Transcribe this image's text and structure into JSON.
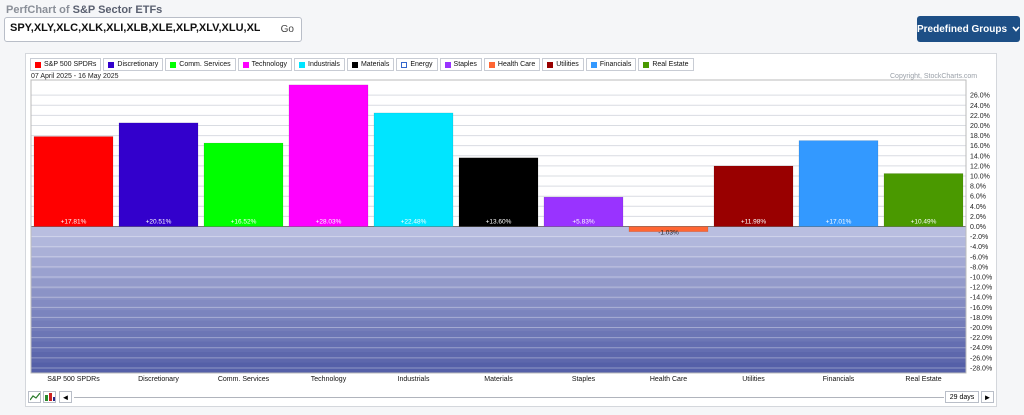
{
  "header": {
    "title_prefix": "PerfChart of ",
    "title_main": "S&P Sector ETFs",
    "symbols_value": "SPY,XLY,XLC,XLK,XLI,XLB,XLE,XLP,XLV,XLU,XLF,XLRE",
    "go_label": "Go",
    "groups_label": "Predefined Groups",
    "groups_icon": "chevron-down-icon"
  },
  "chart_header": {
    "date_range": "07 April 2025 - 16 May 2025",
    "copyright": "Copyright, StockCharts.com"
  },
  "footer": {
    "days_label": "29 days",
    "left_arrow": "◄",
    "right_arrow": "►"
  },
  "chart_data": {
    "type": "bar",
    "categories": [
      "S&P 500 SPDRs",
      "Discretionary",
      "Comm. Services",
      "Technology",
      "Industrials",
      "Materials",
      "Staples",
      "Health Care",
      "Utilities",
      "Financials",
      "Real Estate"
    ],
    "values": [
      17.81,
      20.51,
      16.52,
      28.03,
      22.48,
      13.6,
      5.83,
      -1.03,
      11.98,
      17.01,
      10.49
    ],
    "value_labels": [
      "+17.81%",
      "+20.51%",
      "+16.52%",
      "+28.03%",
      "+22.48%",
      "+13.60%",
      "+5.83%",
      "-1.03%",
      "+11.98%",
      "+17.01%",
      "+10.49%"
    ],
    "colors": [
      "#ff0000",
      "#3300cc",
      "#00ff00",
      "#ff00ff",
      "#00e5ff",
      "#000000",
      "#9933ff",
      "#ff6633",
      "#990000",
      "#3399ff",
      "#4a9900"
    ],
    "legend": [
      {
        "label": "S&P 500 SPDRs",
        "color": "#ff0000"
      },
      {
        "label": "Discretionary",
        "color": "#3300cc"
      },
      {
        "label": "Comm. Services",
        "color": "#00ff00"
      },
      {
        "label": "Technology",
        "color": "#ff00ff"
      },
      {
        "label": "Industrials",
        "color": "#00e5ff"
      },
      {
        "label": "Materials",
        "color": "#000000"
      },
      {
        "label": "Energy",
        "color": "#ffffff"
      },
      {
        "label": "Staples",
        "color": "#9933ff"
      },
      {
        "label": "Health Care",
        "color": "#ff6633"
      },
      {
        "label": "Utilities",
        "color": "#990000"
      },
      {
        "label": "Financials",
        "color": "#3399ff"
      },
      {
        "label": "Real Estate",
        "color": "#4a9900"
      }
    ],
    "yticks": [
      "26.0%",
      "24.0%",
      "22.0%",
      "20.0%",
      "18.0%",
      "16.0%",
      "14.0%",
      "12.0%",
      "10.0%",
      "8.0%",
      "6.0%",
      "4.0%",
      "2.0%",
      "0.0%",
      "-2.0%",
      "-4.0%",
      "-6.0%",
      "-8.0%",
      "-10.0%",
      "-12.0%",
      "-14.0%",
      "-16.0%",
      "-18.0%",
      "-20.0%",
      "-22.0%",
      "-24.0%",
      "-26.0%",
      "-28.0%"
    ],
    "ylim": [
      -29,
      29
    ],
    "grid": true,
    "legend_position": "top-left",
    "negative_region_color": "#5560a8"
  }
}
